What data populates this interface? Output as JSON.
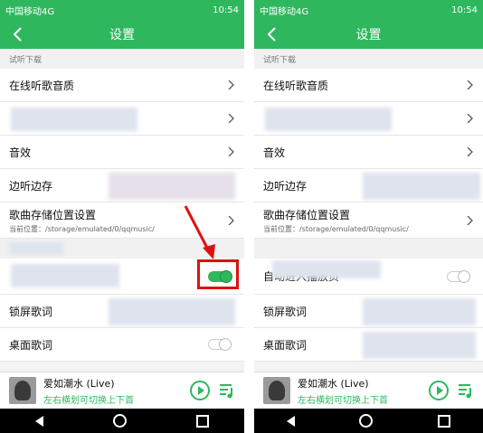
{
  "status": {
    "carrier": "中国移动4G",
    "time": "10:54"
  },
  "titlebar": {
    "title": "设置"
  },
  "section1": "试听下载",
  "rows": {
    "quality": "在线听歌音质",
    "effect": "音效",
    "cache": "边听边存",
    "storage": "歌曲存储位置设置",
    "storage_path": "当前位置：/storage/emulated/0/qqmusic/",
    "autoplay": "自动进入播放页",
    "lyrics_lock": "锁屏歌词",
    "desktop_lyrics": "桌面歌词"
  },
  "player": {
    "title": "爱如潮水 (Live)",
    "subtitle": "左右横划可切换上下首"
  },
  "icons": [
    "back-icon",
    "chevron-right-icon",
    "toggle",
    "play-icon",
    "playlist-icon",
    "nav-back-icon",
    "nav-home-icon",
    "nav-recent-icon"
  ],
  "colors": {
    "brand_green": "#2fb75e",
    "highlight_red": "#dd1111"
  }
}
